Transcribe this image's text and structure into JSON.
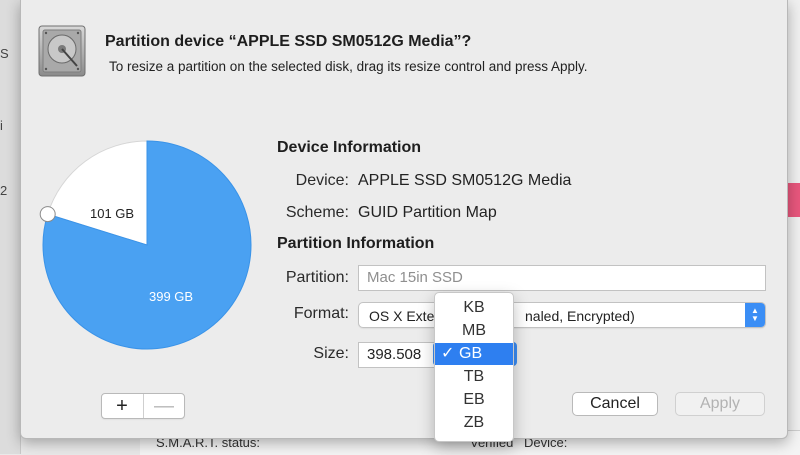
{
  "background": {
    "left_fragments": [
      "S",
      "i",
      "2"
    ],
    "bottom_row": {
      "smart_label": "S.M.A.R.T. status:",
      "smart_value": "Verified",
      "device_label": "Device:"
    }
  },
  "dialog": {
    "title": "Partition device “APPLE SSD SM0512G Media”?",
    "subtitle": "To resize a partition on the selected disk, drag its resize control and press Apply."
  },
  "pie": {
    "slices": [
      {
        "label": "101 GB",
        "gb": 101,
        "color": "#ffffff"
      },
      {
        "label": "399 GB",
        "gb": 399,
        "color": "#4aa1f2"
      }
    ],
    "add_symbol": "+",
    "remove_symbol": "—"
  },
  "device_info": {
    "heading": "Device Information",
    "device_label": "Device:",
    "device_value": "APPLE SSD SM0512G Media",
    "scheme_label": "Scheme:",
    "scheme_value": "GUID Partition Map"
  },
  "partition_info": {
    "heading": "Partition Information",
    "partition_label": "Partition:",
    "partition_placeholder": "Mac 15in SSD",
    "format_label": "Format:",
    "format_value_left": "OS X Exte",
    "format_value_right": "naled, Encrypted)",
    "size_label": "Size:",
    "size_value": "398.508"
  },
  "unit_menu": {
    "options": [
      "KB",
      "MB",
      "GB",
      "TB",
      "EB",
      "ZB"
    ],
    "selected": "GB",
    "check_mark": "✓"
  },
  "buttons": {
    "cancel": "Cancel",
    "apply": "Apply"
  },
  "colors": {
    "accent": "#3b8ef5",
    "menu_selection": "#2e7ff0",
    "pie_blue": "#4aa1f2"
  }
}
